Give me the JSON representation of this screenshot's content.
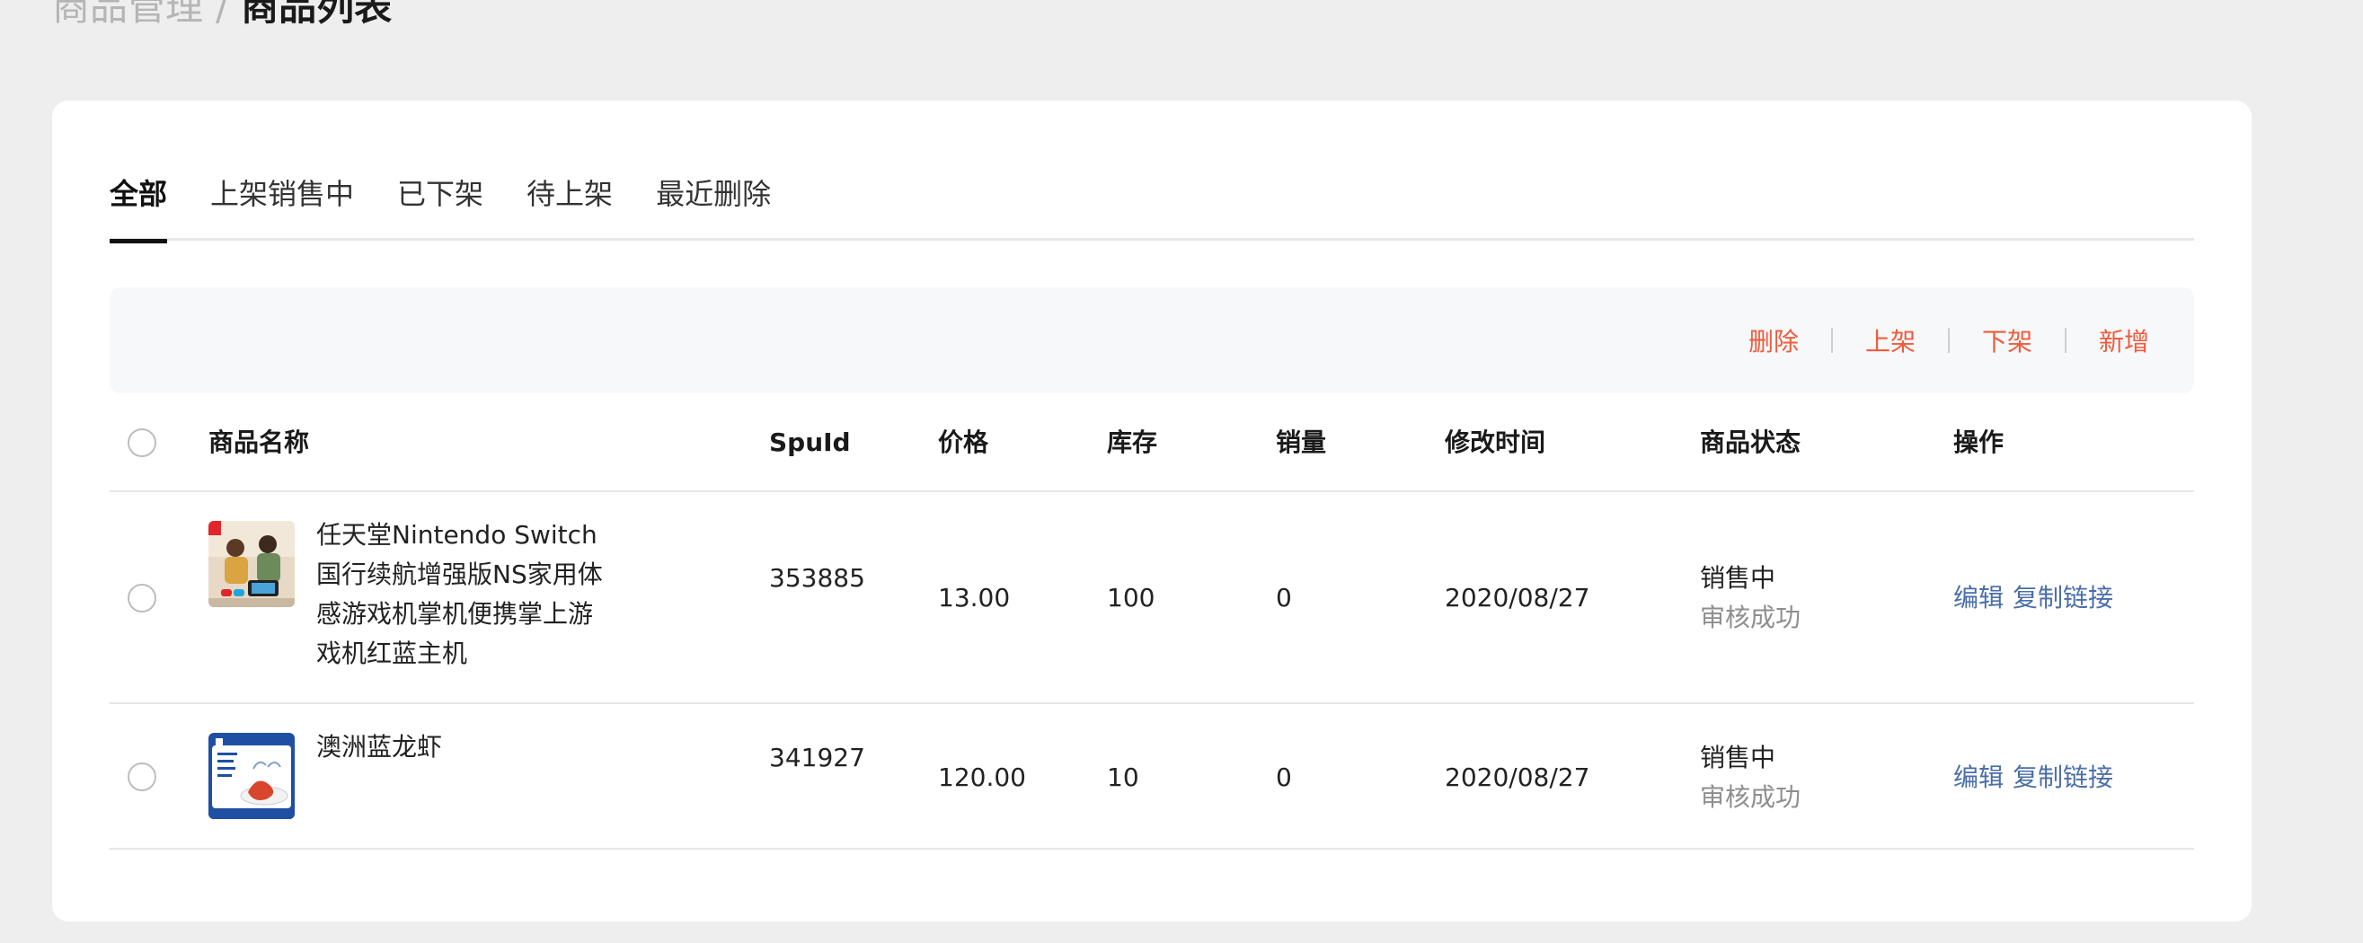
{
  "breadcrumb": {
    "parent": "商品管理",
    "separator": "/",
    "current": "商品列表"
  },
  "tabs": [
    {
      "label": "全部",
      "active": true
    },
    {
      "label": "上架销售中",
      "active": false
    },
    {
      "label": "已下架",
      "active": false
    },
    {
      "label": "待上架",
      "active": false
    },
    {
      "label": "最近删除",
      "active": false
    }
  ],
  "toolbar": {
    "delete": "删除",
    "on_shelf": "上架",
    "off_shelf": "下架",
    "add": "新增"
  },
  "table": {
    "headers": {
      "name": "商品名称",
      "spu": "SpuId",
      "price": "价格",
      "stock": "库存",
      "sales": "销量",
      "time": "修改时间",
      "status": "商品状态",
      "ops": "操作"
    },
    "rows": [
      {
        "name": "任天堂Nintendo Switch国行续航增强版NS家用体感游戏机掌机便携掌上游戏机红蓝主机",
        "spu": "353885",
        "price": "13.00",
        "stock": "100",
        "sales": "0",
        "time": "2020/08/27",
        "status": "销售中",
        "audit": "审核成功",
        "edit": "编辑",
        "copy": "复制链接"
      },
      {
        "name": "澳洲蓝龙虾",
        "spu": "341927",
        "price": "120.00",
        "stock": "10",
        "sales": "0",
        "time": "2020/08/27",
        "status": "销售中",
        "audit": "审核成功",
        "edit": "编辑",
        "copy": "复制链接"
      }
    ]
  },
  "colors": {
    "accent": "#f05b3c",
    "link": "#4a6ea9",
    "muted": "#8e8e8e"
  }
}
